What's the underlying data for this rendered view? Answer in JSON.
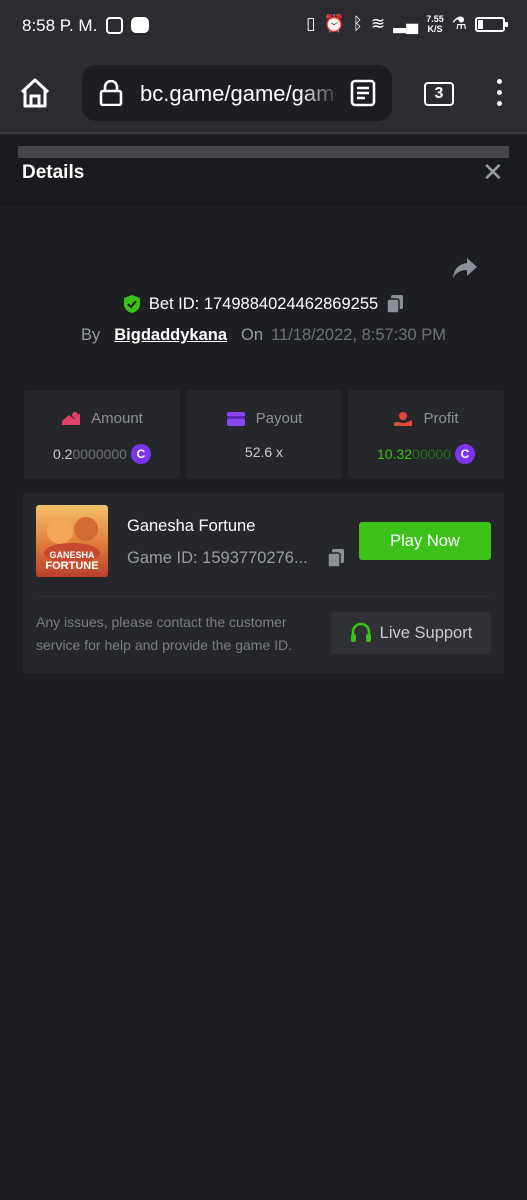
{
  "status_bar": {
    "time": "8:58 P. M.",
    "network_speed_value": "7.55",
    "network_speed_unit": "K/S",
    "battery_level": 0.2
  },
  "browser": {
    "url": "bc.game/game/game",
    "tab_count": "3"
  },
  "modal": {
    "title": "Details"
  },
  "bet": {
    "bet_id": "Bet ID: 1749884024462869255",
    "by_label": "By",
    "username": "Bigdaddykana",
    "on_label": "On",
    "date": "11/18/2022, 8:57:30 PM"
  },
  "stats": {
    "amount_label": "Amount",
    "amount_main": "0.2",
    "amount_rest": "0000000",
    "payout_label": "Payout",
    "payout_value": "52.6 x",
    "profit_label": "Profit",
    "profit_main": "10.32",
    "profit_rest": "00000",
    "coin_symbol": "C"
  },
  "game": {
    "thumb_line1": "GANESHA",
    "thumb_line2": "FORTUNE",
    "name": "Ganesha Fortune",
    "id": "Game ID: 1593770276...",
    "play_label": "Play Now",
    "issue_text": "Any issues, please contact the customer service for help and provide the game ID.",
    "live_support_label": "Live Support"
  },
  "colors": {
    "accent_green": "#3bc117",
    "profit_green": "#3bc117",
    "coin_purple": "#7b35f0",
    "amount_pink": "#e2416b",
    "payout_purple": "#8b46f3",
    "profit_red": "#e8453c",
    "shield_green": "#3bc117"
  }
}
